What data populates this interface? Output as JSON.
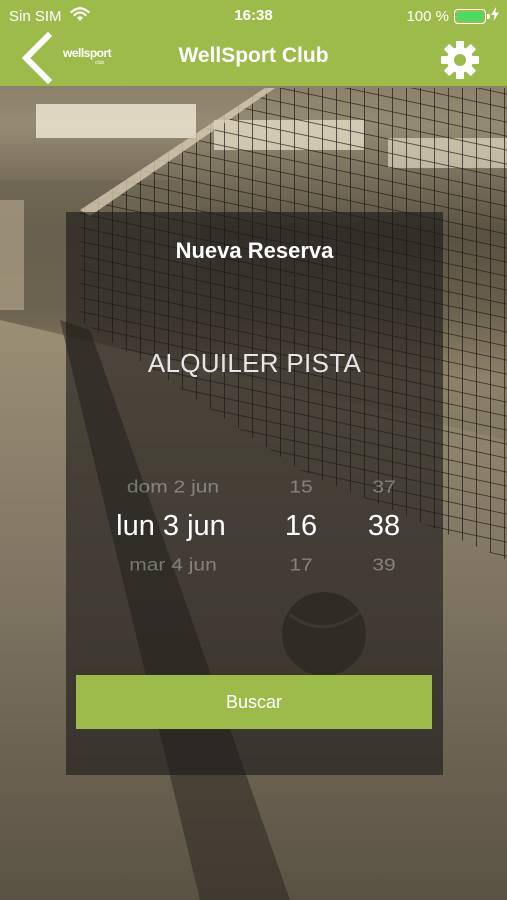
{
  "status_bar": {
    "carrier": "Sin SIM",
    "time": "16:38",
    "battery_percent": "100 %",
    "battery_level": 1.0,
    "icons": [
      "wifi-icon",
      "battery-icon",
      "charging-icon"
    ]
  },
  "nav": {
    "title": "WellSport Club",
    "logo_text": "wellsport",
    "logo_sub": "club",
    "back_icon": "chevron-left-icon",
    "settings_icon": "gear-icon"
  },
  "booking": {
    "title": "Nueva Reserva",
    "service": "ALQUILER PISTA",
    "picker": {
      "prev": {
        "day": "dom 2 jun",
        "hour": "15",
        "minute": "37"
      },
      "selected": {
        "day": "lun 3 jun",
        "hour": "16",
        "minute": "38"
      },
      "next": {
        "day": "mar 4 jun",
        "hour": "17",
        "minute": "39"
      }
    },
    "search_label": "Buscar"
  },
  "colors": {
    "accent": "#9dbb4b",
    "text": "#ffffff",
    "battery_fill": "#4cd964"
  }
}
